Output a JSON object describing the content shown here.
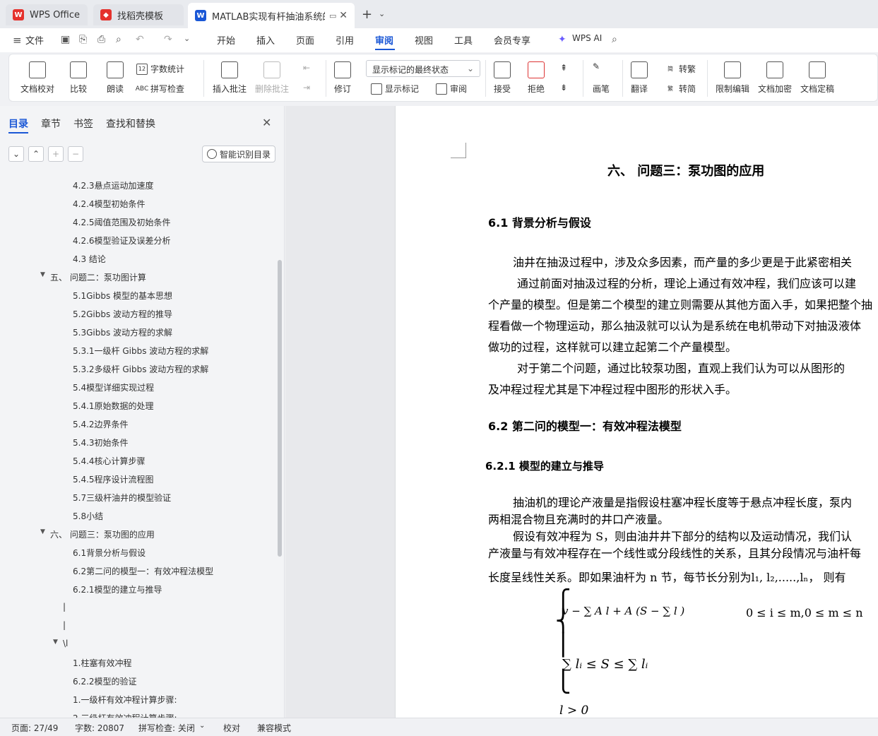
{
  "tabs": [
    {
      "label": "WPS Office"
    },
    {
      "label": "找稻壳模板"
    },
    {
      "label": "MATLAB实现有杆抽油系统的…"
    }
  ],
  "menu": {
    "file": "文件",
    "items": [
      "开始",
      "插入",
      "页面",
      "引用",
      "审阅",
      "视图",
      "工具",
      "会员专享"
    ],
    "active": "审阅",
    "wps_ai": "WPS AI"
  },
  "ribbon": {
    "doc_check": "文档校对",
    "compare": "比较",
    "read_aloud": "朗读",
    "word_count": "字数统计",
    "spell_check": "拼写检查",
    "insert_comment": "插入批注",
    "delete_comment": "删除批注",
    "revise": "修订",
    "markup_select": "显示标记的最终状态",
    "show_markup": "显示标记",
    "review": "审阅",
    "accept": "接受",
    "reject": "拒绝",
    "pen": "画笔",
    "translate": "翻译",
    "to_traditional": "转繁",
    "to_simplified": "转简",
    "restrict_edit": "限制编辑",
    "doc_encrypt": "文档加密",
    "doc_finalize": "文档定稿"
  },
  "nav": {
    "tabs": [
      "目录",
      "章节",
      "书签",
      "查找和替换"
    ],
    "smart_toc": "智能识别目录",
    "toc": [
      {
        "label": "4.2.3悬点运动加速度",
        "indent": 103
      },
      {
        "label": "4.2.4模型初始条件",
        "indent": 103
      },
      {
        "label": "4.2.5阈值范围及初始条件",
        "indent": 103
      },
      {
        "label": "4.2.6模型验证及误差分析",
        "indent": 103
      },
      {
        "label": "4.3 结论",
        "indent": 103
      },
      {
        "label": "五、 问题二：泵功图计算",
        "indent": 71,
        "expanded": true
      },
      {
        "label": "5.1Gibbs 模型的基本思想",
        "indent": 103
      },
      {
        "label": "5.2Gibbs 波动方程的推导",
        "indent": 103
      },
      {
        "label": "5.3Gibbs 波动方程的求解",
        "indent": 103
      },
      {
        "label": "5.3.1一级杆 Gibbs 波动方程的求解",
        "indent": 103
      },
      {
        "label": "5.3.2多级杆 Gibbs 波动方程的求解",
        "indent": 103
      },
      {
        "label": "5.4模型详细实现过程",
        "indent": 103
      },
      {
        "label": "5.4.1原始数据的处理",
        "indent": 103
      },
      {
        "label": "5.4.2边界条件",
        "indent": 103
      },
      {
        "label": "5.4.3初始条件",
        "indent": 103
      },
      {
        "label": "5.4.4核心计算步骤",
        "indent": 103
      },
      {
        "label": "5.4.5程序设计流程图",
        "indent": 103
      },
      {
        "label": "5.7三级杆油井的模型验证",
        "indent": 103
      },
      {
        "label": "5.8小结",
        "indent": 103
      },
      {
        "label": "六、 问题三：泵功图的应用",
        "indent": 71,
        "expanded": true
      },
      {
        "label": "6.1背景分析与假设",
        "indent": 103
      },
      {
        "label": "6.2第二问的模型一：有效冲程法模型",
        "indent": 103
      },
      {
        "label": "6.2.1模型的建立与推导",
        "indent": 103
      },
      {
        "label": "|",
        "indent": 89
      },
      {
        "label": "|",
        "indent": 89
      },
      {
        "label": "\\l",
        "indent": 89,
        "expanded": true
      },
      {
        "label": "1.柱塞有效冲程",
        "indent": 103
      },
      {
        "label": "6.2.2模型的验证",
        "indent": 103
      },
      {
        "label": "1.一级杆有效冲程计算步骤:",
        "indent": 103
      },
      {
        "label": "2.三级杆有效冲程计算步骤:",
        "indent": 103
      }
    ]
  },
  "document": {
    "h1": "六、  问题三：泵功图的应用",
    "h2_61": "6.1  背景分析与假设",
    "p1": "油井在抽汲过程中，涉及众多因素，而产量的多少更是于此紧密相关",
    "p2": "通过前面对抽汲过程的分析，理论上通过有效冲程，我们应该可以建",
    "p3": "个产量的模型。但是第二个模型的建立则需要从其他方面入手，如果把整个抽",
    "p4": "程看做一个物理运动，那么抽汲就可以认为是系统在电机带动下对抽汲液体",
    "p5": "做功的过程，这样就可以建立起第二个产量模型。",
    "p6": "对于第二个问题，通过比较泵功图，直观上我们认为可以从图形的",
    "p7": "及冲程过程尤其是下冲程过程中图形的形状入手。",
    "h2_62": "6.2  第二问的模型一：有效冲程法模型",
    "h3_621": "6.2.1   模型的建立与推导",
    "p8": "抽油机的理论产液量是指假设柱塞冲程长度等于悬点冲程长度，泵内",
    "p9": "两相混合物且充满时的井口产液量。",
    "p10": "假设有效冲程为  S，则由油井井下部分的结构以及运动情况，我们认",
    "p11": "产液量与有效冲程存在一个线性或分段线性的关系，且其分段情况与油杆每",
    "p12": "长度呈线性关系。即如果油杆为  n 节，每节长分别为l₁, l₂,.....,lₙ，  则有",
    "math_cond1": "0 ≤ i ≤ m,0 ≤ m ≤ n",
    "math_sum": "∑ lᵢ ≤ S ≤ ∑ lᵢ",
    "math_l": "l > 0"
  },
  "status": {
    "page": "页面: 27/49",
    "words": "字数: 20807",
    "spell": "拼写检查: 关闭",
    "proof": "校对",
    "compat": "兼容模式"
  },
  "colors": {
    "accent": "#1a57d6",
    "wps_red": "#e5322d"
  }
}
